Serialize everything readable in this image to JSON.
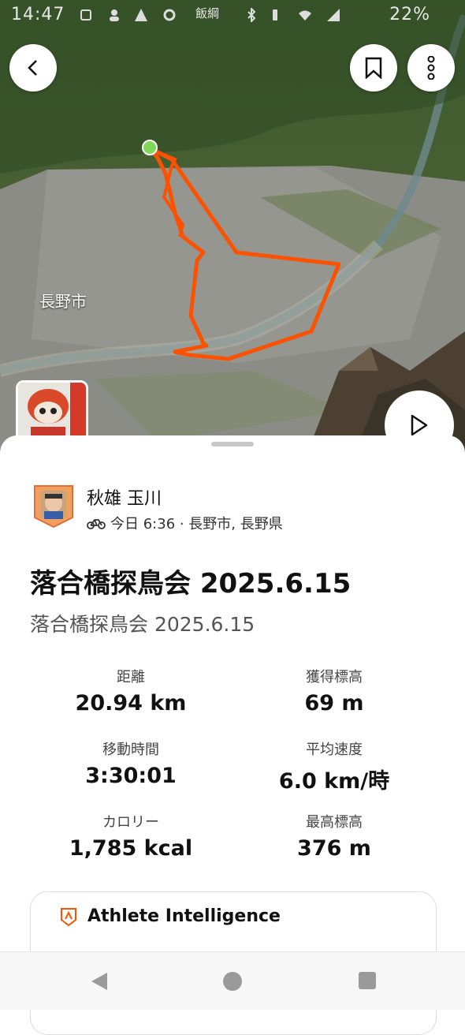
{
  "status_bar": {
    "time": "14:47",
    "carrier": "飯綱",
    "battery": "22%"
  },
  "map": {
    "place_label": "長野市",
    "route_color": "#fc5200",
    "start_marker_color": "#7ed957"
  },
  "athlete": {
    "name": "秋雄 玉川",
    "activity_time": "今日 6:36 · 長野市, 長野県",
    "activity_icon": "bicycle-icon"
  },
  "activity": {
    "title": "落合橋探鳥会 2025.6.15",
    "description": "落合橋探鳥会 2025.6.15"
  },
  "stats": [
    {
      "label": "距離",
      "value": "20.94 km"
    },
    {
      "label": "獲得標高",
      "value": "69 m"
    },
    {
      "label": "移動時間",
      "value": "3:30:01"
    },
    {
      "label": "平均速度",
      "value": "6.0 km/時"
    },
    {
      "label": "カロリー",
      "value": "1,785 kcal"
    },
    {
      "label": "最高標高",
      "value": "376 m"
    }
  ],
  "athlete_intelligence": {
    "title": "Athlete Intelligence",
    "icon": "strava-ai-icon"
  },
  "colors": {
    "brand": "#fc5200",
    "text_primary": "#111111",
    "text_secondary": "#555555"
  }
}
